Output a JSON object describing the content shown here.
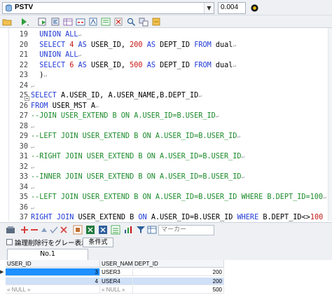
{
  "connection": {
    "name": "PSTV",
    "elapsed": "0.004"
  },
  "toolbar": {
    "icons": [
      "open-folder-icon",
      "run-menu-icon",
      "execute-icon",
      "format-icon",
      "tables-icon",
      "views-icon",
      "procs-icon",
      "explain-icon",
      "clear-icon",
      "find-icon",
      "replace-icon",
      "settings-icon"
    ]
  },
  "editor": {
    "lines": [
      {
        "n": "19",
        "t": "  UNION ALL"
      },
      {
        "n": "20",
        "t": "  SELECT 4 AS USER_ID, 200 AS DEPT_ID FROM dual"
      },
      {
        "n": "21",
        "t": "  UNION ALL"
      },
      {
        "n": "22",
        "t": "  SELECT 6 AS USER_ID, 500 AS DEPT_ID FROM dual"
      },
      {
        "n": "23",
        "t": "  )"
      },
      {
        "n": "24",
        "t": ""
      },
      {
        "n": "25",
        "t": "SELECT A.USER_ID, A.USER_NAME,B.DEPT_ID"
      },
      {
        "n": "26",
        "t": "FROM USER_MST A"
      },
      {
        "n": "27",
        "t": "--JOIN USER_EXTEND B ON A.USER_ID=B.USER_ID"
      },
      {
        "n": "28",
        "t": ""
      },
      {
        "n": "29",
        "t": "--LEFT JOIN USER_EXTEND B ON A.USER_ID=B.USER_ID"
      },
      {
        "n": "30",
        "t": ""
      },
      {
        "n": "31",
        "t": "--RIGHT JOIN USER_EXTEND B ON A.USER_ID=B.USER_ID"
      },
      {
        "n": "32",
        "t": ""
      },
      {
        "n": "33",
        "t": "--INNER JOIN USER_EXTEND B ON A.USER_ID=B.USER_ID"
      },
      {
        "n": "34",
        "t": ""
      },
      {
        "n": "35",
        "t": "--LEFT JOIN USER_EXTEND B ON A.USER_ID=B.USER_ID WHERE B.DEPT_ID=100"
      },
      {
        "n": "36",
        "t": ""
      },
      {
        "n": "37",
        "t": "RIGHT JOIN USER_EXTEND B ON A.USER_ID=B.USER_ID WHERE B.DEPT_ID<>100"
      }
    ]
  },
  "grid_toolbar": {
    "marker_placeholder": "マーカー"
  },
  "options": {
    "gray_deleted_label": "論理削除行をグレー表示",
    "condition_button": "条件式"
  },
  "result_tabs": [
    "No.1"
  ],
  "result": {
    "columns": [
      "USER_ID",
      "USER_NAME",
      "DEPT_ID"
    ],
    "rows": [
      [
        "3",
        "USER3",
        "200"
      ],
      [
        "4",
        "USER4",
        "200"
      ],
      [
        "« NULL »",
        "« NULL »",
        "500"
      ]
    ]
  },
  "colors": {
    "keyword": "#1f39d6",
    "number": "#c81414",
    "comment": "#1a8a2a",
    "selection": "#1e90ff",
    "row_highlight": "#cfe0f7"
  }
}
